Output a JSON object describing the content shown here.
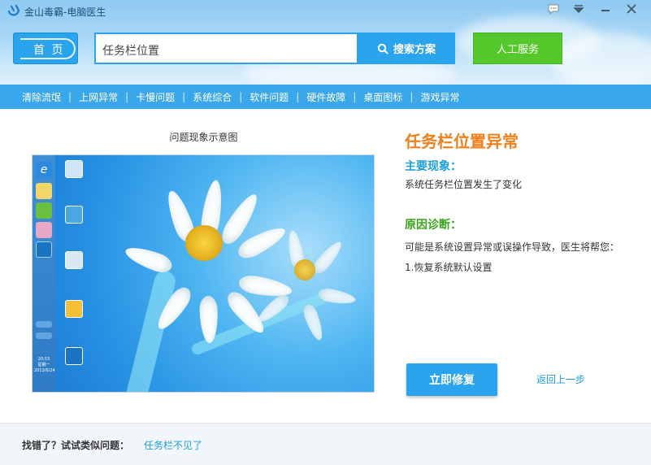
{
  "window": {
    "title": "金山毒霸-电脑医生"
  },
  "header": {
    "home_label": "首 页",
    "search_value": "任务栏位置",
    "search_button": "搜索方案",
    "service_button": "人工服务"
  },
  "nav": {
    "items": [
      "清除流氓",
      "上网异常",
      "卡慢问题",
      "系统综合",
      "软件问题",
      "硬件故障",
      "桌面图标",
      "游戏异常"
    ],
    "separator": "|"
  },
  "preview": {
    "caption": "问题现象示意图",
    "clock_time": "20:53",
    "clock_day": "星期一",
    "clock_date": "2013/6/24"
  },
  "issue": {
    "title": "任务栏位置异常",
    "symptom_heading": "主要现象：",
    "symptom_text": "系统任务栏位置发生了变化",
    "diagnosis_heading": "原因诊断：",
    "diagnosis_text": "可能是系统设置异常或误操作导致，医生将帮您：",
    "step_1": "1.恢复系统默认设置"
  },
  "actions": {
    "fix_button": "立即修复",
    "back_link": "返回上一步"
  },
  "footer": {
    "label": "找错了？试试类似问题：",
    "related_link": "任务栏不见了"
  },
  "colors": {
    "accent_blue": "#2aa4ec",
    "green": "#55c92b",
    "orange_title": "#f07f19",
    "link_blue": "#1d9fd8"
  },
  "icons": [
    "app-logo-icon",
    "chat-icon",
    "menu-icon",
    "minimize-icon",
    "close-icon",
    "search-icon"
  ]
}
